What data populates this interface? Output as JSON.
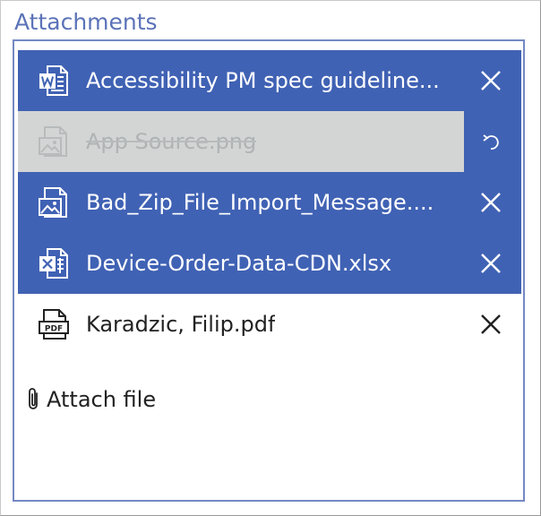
{
  "panel": {
    "title": "Attachments",
    "accent_color": "#4062b4",
    "title_color": "#5b73b8"
  },
  "attachments": [
    {
      "name": "Accessibility PM spec guideline...",
      "icon": "word-document-icon",
      "state": "selected",
      "action": "remove"
    },
    {
      "name": "App Source.png",
      "icon": "image-file-icon",
      "state": "deleted",
      "action": "undo"
    },
    {
      "name": "Bad_Zip_File_Import_Message....",
      "icon": "image-file-icon",
      "state": "selected",
      "action": "remove"
    },
    {
      "name": "Device-Order-Data-CDN.xlsx",
      "icon": "excel-document-icon",
      "state": "selected",
      "action": "remove"
    },
    {
      "name": "Karadzic, Filip.pdf",
      "icon": "pdf-file-icon",
      "state": "normal",
      "action": "remove"
    }
  ],
  "attach": {
    "label": "Attach file",
    "icon": "paperclip-icon"
  }
}
